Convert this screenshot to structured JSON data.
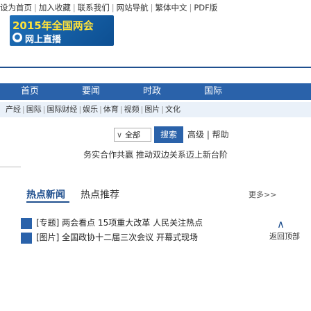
{
  "top_links": [
    "设为首页",
    "加入收藏",
    "联系我们",
    "网站导航",
    "繁体中文",
    "PDF版"
  ],
  "banner": {
    "line1": "2015年全国两会",
    "line2": "网上直播"
  },
  "nav": [
    "首页",
    "要闻",
    "时政",
    "国际"
  ],
  "subnav": [
    "产经",
    "国际",
    "国际财经",
    "娱乐",
    "体育",
    "视频",
    "图片",
    "文化"
  ],
  "search": {
    "select_value": "全部",
    "button_label": "搜索",
    "extra_label": "高级 | 帮助"
  },
  "slogan": "务实合作共赢 推动双边关系迈上新台阶",
  "tabs": {
    "active": "热点新闻",
    "other": "热点推荐"
  },
  "more": "更多>>",
  "news": [
    "[专题] 两会看点 15项重大改革 人民关注热点",
    "[图片] 全国政协十二届三次会议 开幕式现场"
  ],
  "back_to_top": "返回顶部"
}
